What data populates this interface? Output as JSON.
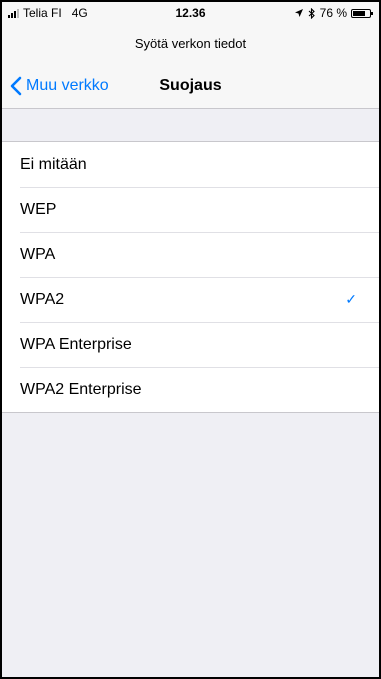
{
  "status_bar": {
    "carrier": "Telia FI",
    "network": "4G",
    "time": "12.36",
    "location_icon": "location-arrow-icon",
    "bluetooth_icon": "bluetooth-icon",
    "battery_label": "76 %",
    "battery_level": 0.76
  },
  "prompt": "Syötä verkon tiedot",
  "nav": {
    "back_label": "Muu verkko",
    "title": "Suojaus"
  },
  "security_options": [
    {
      "label": "Ei mitään",
      "selected": false
    },
    {
      "label": "WEP",
      "selected": false
    },
    {
      "label": "WPA",
      "selected": false
    },
    {
      "label": "WPA2",
      "selected": true
    },
    {
      "label": "WPA Enterprise",
      "selected": false
    },
    {
      "label": "WPA2 Enterprise",
      "selected": false
    }
  ],
  "checkmark": "✓",
  "colors": {
    "accent": "#007aff",
    "background": "#efeff4"
  }
}
